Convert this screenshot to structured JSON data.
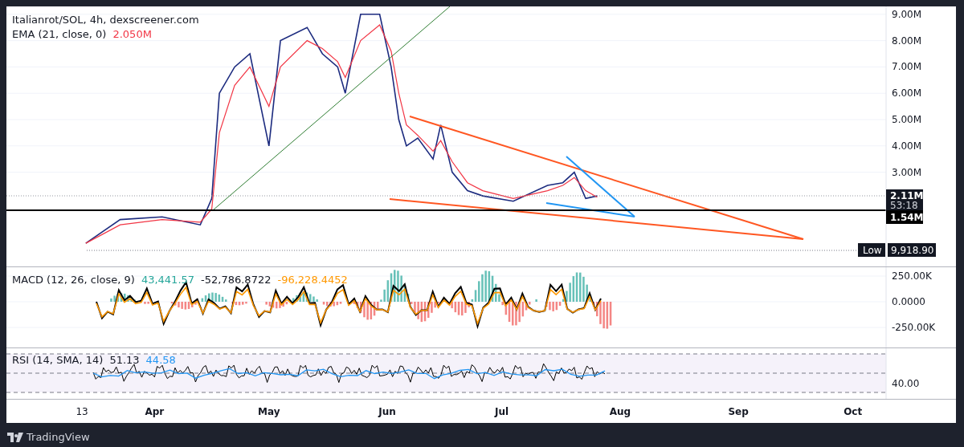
{
  "price_pane": {
    "legend": {
      "symbol": "Italianrot/SOL, 4h, dexscreener.com",
      "ema_label": "EMA (21, close, 0)",
      "ema_value": "2.050M"
    },
    "axis_labels": [
      "9.00M",
      "8.00M",
      "7.00M",
      "6.00M",
      "5.00M",
      "4.00M",
      "3.00M"
    ],
    "last_price_tag": {
      "price": "2.11M",
      "countdown": "53:18"
    },
    "line_tag": "1.54M",
    "low_tag": {
      "label": "Low",
      "value": "9,918.90"
    }
  },
  "macd_pane": {
    "legend": {
      "label": "MACD (12, 26, close, 9)",
      "histogram": "43,441.57",
      "macd": "-52,786.8722",
      "signal": "-96,228.4452"
    },
    "axis_labels": [
      "250.00K",
      "0.0000",
      "-250.00K"
    ]
  },
  "rsi_pane": {
    "legend": {
      "label": "RSI (14, SMA, 14)",
      "rsi": "51.13",
      "sma": "44.58"
    },
    "axis_labels": [
      "40.00"
    ]
  },
  "time_axis": [
    "13",
    "Apr",
    "May",
    "Jun",
    "Jul",
    "Aug",
    "Sep",
    "Oct"
  ],
  "footer": {
    "brand": "TradingView"
  }
}
